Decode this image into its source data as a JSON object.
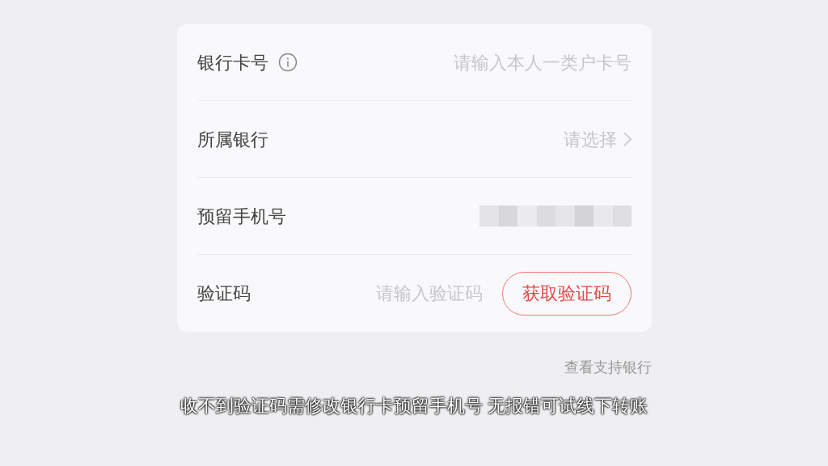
{
  "form": {
    "rows": [
      {
        "kind": "input",
        "label": "银行卡号",
        "info": true,
        "placeholder": "请输入本人一类户卡号"
      },
      {
        "kind": "select",
        "label": "所属银行",
        "placeholder": "请选择"
      },
      {
        "kind": "masked",
        "label": "预留手机号"
      },
      {
        "kind": "code",
        "label": "验证码",
        "placeholder": "请输入验证码",
        "button": "获取验证码"
      }
    ]
  },
  "link": "查看支持银行",
  "subtitle": "收不到验证码需修改银行卡预留手机号 无报错可试线下转账"
}
